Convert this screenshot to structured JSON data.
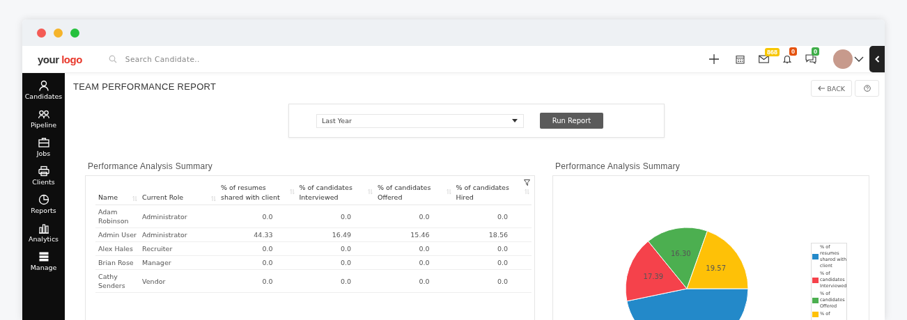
{
  "header": {
    "logo": {
      "part_1": "your",
      "part_2": "logo"
    },
    "search": {
      "placeholder": "Search Candidate.."
    },
    "badges": [
      {
        "kind": "mail",
        "count": "868",
        "color": "#f7c600"
      },
      {
        "kind": "bell",
        "count": "0",
        "color": "#e5530f"
      },
      {
        "kind": "chat",
        "count": "0",
        "color": "#3fae49"
      }
    ]
  },
  "sidebar": {
    "items": [
      {
        "kind": "person",
        "label": "Candidates"
      },
      {
        "kind": "people",
        "label": "Pipeline"
      },
      {
        "kind": "briefcase",
        "label": "Jobs"
      },
      {
        "kind": "clients",
        "label": "Clients"
      },
      {
        "kind": "pie",
        "label": "Reports"
      },
      {
        "kind": "bars",
        "label": "Analytics"
      },
      {
        "kind": "stack",
        "label": "Manage"
      }
    ]
  },
  "page": {
    "title": "TEAM PERFORMANCE REPORT",
    "back": "BACK"
  },
  "filter": {
    "period": "Last Year",
    "run": "Run Report"
  },
  "table_panel": {
    "title": "Performance Analysis Summary",
    "columns": [
      "Name",
      "Current Role",
      "% of resumes shared with client",
      "% of candidates Interviewed",
      "% of candidates Offered",
      "% of candidates Hired"
    ],
    "rows": [
      [
        "Adam Robinson",
        "Administrator",
        "0.0",
        "0.0",
        "0.0",
        "0.0"
      ],
      [
        "Admin User",
        "Administrator",
        "44.33",
        "16.49",
        "15.46",
        "18.56"
      ],
      [
        "Alex Hales",
        "Recruiter",
        "0.0",
        "0.0",
        "0.0",
        "0.0"
      ],
      [
        "Brian Rose",
        "Manager",
        "0.0",
        "0.0",
        "0.0",
        "0.0"
      ],
      [
        "Cathy Senders",
        "Vendor",
        "0.0",
        "0.0",
        "0.0",
        "0.0"
      ]
    ]
  },
  "chart_panel": {
    "title": "Performance Analysis Summary",
    "chart_data": {
      "type": "pie",
      "data_labels": true,
      "legend": "right",
      "categories": [
        "% of resumes shared with client",
        "% of candidates Interviewed",
        "% of candidates Offered",
        "% of"
      ],
      "colors": [
        "#2389c9",
        "#f5424b",
        "#4caf50",
        "#fec107"
      ],
      "values": [
        46.74,
        17.39,
        16.3,
        19.57
      ],
      "value_labels": [
        null,
        "17.39",
        "16.30",
        "19.57"
      ]
    }
  }
}
